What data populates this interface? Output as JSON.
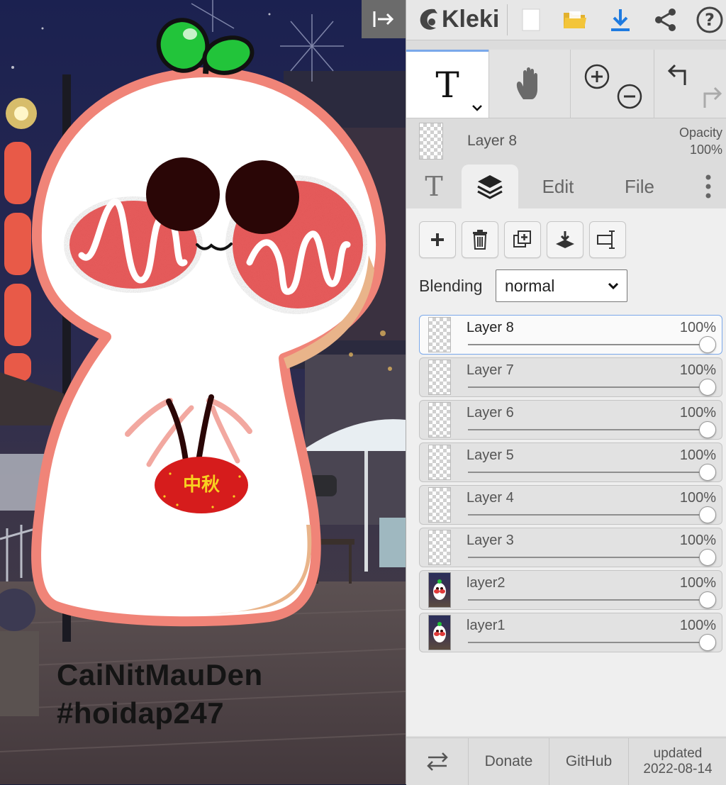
{
  "canvas": {
    "text_line1": "CaiNitMauDen",
    "text_line2": "#hoidap247",
    "badge_text": "中秋"
  },
  "app": {
    "name": "Kleki"
  },
  "topbar": {
    "icons": [
      "collapse-panel-icon",
      "new-file-icon",
      "open-folder-icon",
      "download-icon",
      "share-icon",
      "help-icon"
    ],
    "help_glyph": "?"
  },
  "tools": {
    "text_tool_glyph": "T",
    "items": [
      "text-tool",
      "hand-tool",
      "zoom-in",
      "zoom-out",
      "undo",
      "redo"
    ]
  },
  "current_layer": {
    "name": "Layer 8",
    "opacity_label": "Opacity",
    "opacity_value": "100%"
  },
  "tabs": {
    "brush_glyph": "T",
    "edit": "Edit",
    "file": "File"
  },
  "layer_buttons": [
    "add-layer",
    "delete-layer",
    "duplicate-layer",
    "merge-down",
    "rename-layer"
  ],
  "blending": {
    "label": "Blending",
    "value": "normal"
  },
  "layers": [
    {
      "name": "Layer 8",
      "opacity": "100%",
      "selected": true,
      "thumb": "transparent"
    },
    {
      "name": "Layer 7",
      "opacity": "100%",
      "selected": false,
      "thumb": "transparent"
    },
    {
      "name": "Layer 6",
      "opacity": "100%",
      "selected": false,
      "thumb": "transparent"
    },
    {
      "name": "Layer 5",
      "opacity": "100%",
      "selected": false,
      "thumb": "transparent"
    },
    {
      "name": "Layer 4",
      "opacity": "100%",
      "selected": false,
      "thumb": "transparent"
    },
    {
      "name": "Layer 3",
      "opacity": "100%",
      "selected": false,
      "thumb": "transparent"
    },
    {
      "name": "layer2",
      "opacity": "100%",
      "selected": false,
      "thumb": "photo"
    },
    {
      "name": "layer1",
      "opacity": "100%",
      "selected": false,
      "thumb": "photo"
    }
  ],
  "footer": {
    "donate": "Donate",
    "github": "GitHub",
    "updated_label": "updated",
    "updated_date": "2022-08-14"
  },
  "colors": {
    "accent_blue": "#1f7be0",
    "folder_yellow": "#f3c53a",
    "selected_border": "#7aa8ea",
    "char_outline": "#f08478",
    "cheek_red": "#e03a3a"
  }
}
